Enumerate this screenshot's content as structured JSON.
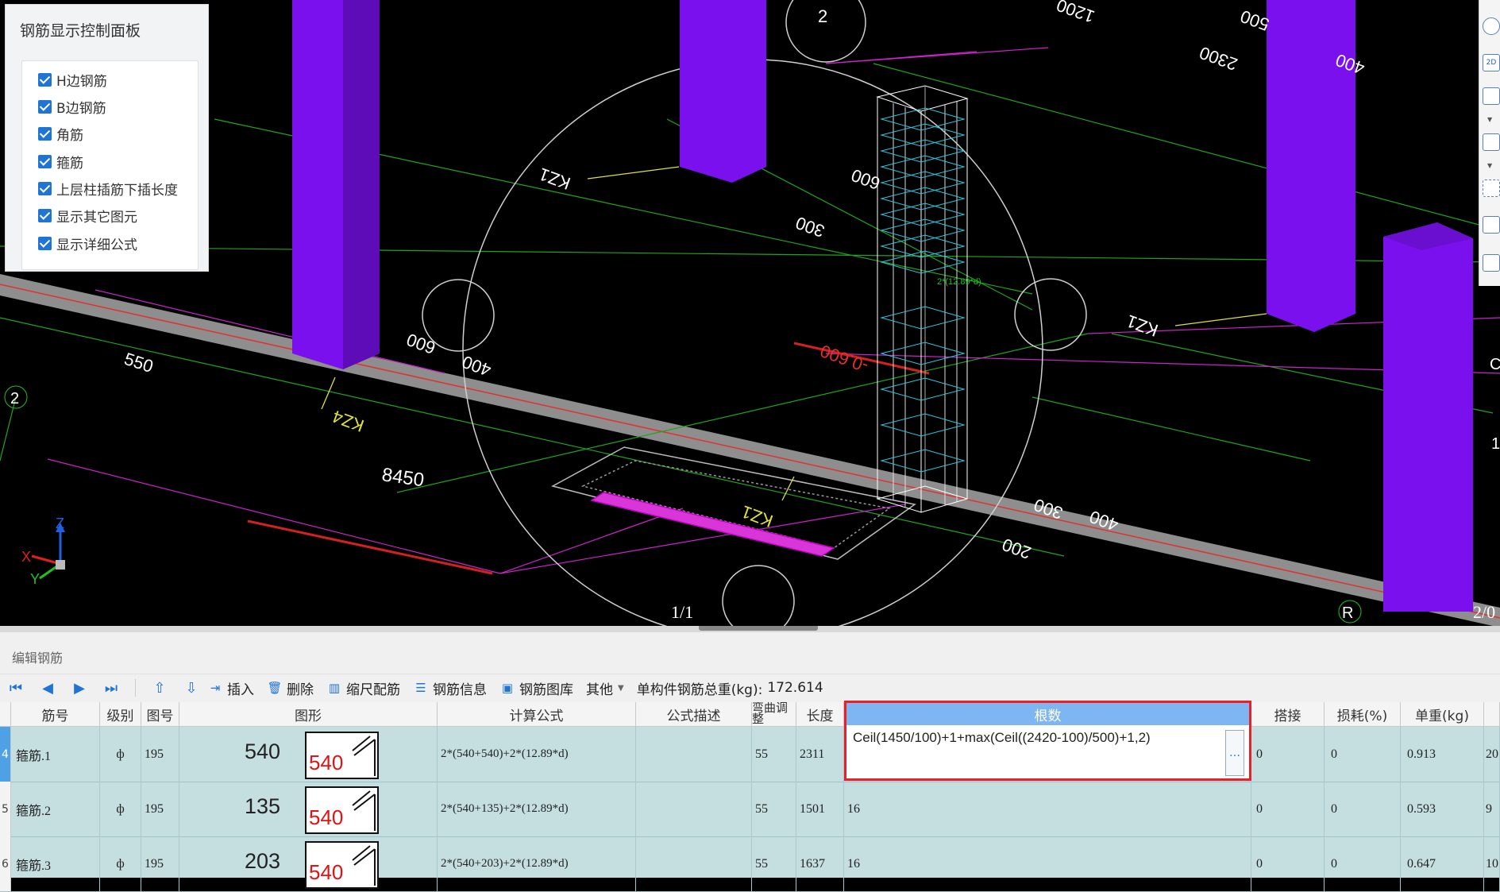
{
  "control_panel": {
    "title": "钢筋显示控制面板",
    "options": [
      {
        "label": "H边钢筋",
        "checked": true
      },
      {
        "label": "B边钢筋",
        "checked": true
      },
      {
        "label": "角筋",
        "checked": true
      },
      {
        "label": "箍筋",
        "checked": true
      },
      {
        "label": "上层柱插筋下插长度",
        "checked": true
      },
      {
        "label": "显示其它图元",
        "checked": true
      },
      {
        "label": "显示详细公式",
        "checked": true
      }
    ]
  },
  "scene": {
    "dims": {
      "d8450": "8450",
      "d550": "550",
      "d400a": "400",
      "d600": "600",
      "d300": "300",
      "d400b": "400",
      "d300b": "300",
      "d200": "200",
      "d2300": "2300",
      "d400c": "400",
      "d1200": "1200",
      "d500": "500",
      "d600b": "600"
    },
    "labels": {
      "kz1_top": "KZ1",
      "kz1_right": "KZ1",
      "kz4": "KZ4",
      "kz1_bottom": "KZ1",
      "level": "-0.600",
      "axis_2_top": "2",
      "axis_2_left": "2",
      "axis_r": "R",
      "page_left": "1/1",
      "page_right": "2/0",
      "edge_1": "1",
      "edge_c": "C",
      "formula_tag": "2*(12.89*d)"
    },
    "axes": {
      "z": "Z",
      "x": "X",
      "y": "Y"
    }
  },
  "right_toolbar": {
    "btn_2d": "2D"
  },
  "editor": {
    "title": "编辑钢筋",
    "toolbar": {
      "insert": "插入",
      "delete": "删除",
      "scale": "缩尺配筋",
      "info": "钢筋信息",
      "library": "钢筋图库",
      "other": "其他",
      "total_label": "单构件钢筋总重(kg):",
      "total_value": "172.614"
    },
    "columns": {
      "jinhao": "筋号",
      "jibie": "级别",
      "tuhao": "图号",
      "tuxing": "图形",
      "gongshi": "计算公式",
      "miaoshu": "公式描述",
      "wanqu": "弯曲调整",
      "changdu": "长度",
      "genshu": "根数",
      "dajie": "搭接",
      "sunhao": "损耗(%)",
      "danzhong": "单重(kg)"
    },
    "rows": [
      {
        "idx": "4",
        "name": "箍筋.1",
        "grade": "ф",
        "fig": "195",
        "dim": "540",
        "shape_label": "540",
        "formula": "2*(540+540)+2*(12.89*d)",
        "desc": "",
        "bend": "55",
        "length": "2311",
        "count": "Ceil(1450/100)+1+max(Ceil((2420-100)/500)+1,2)",
        "lap": "0",
        "loss": "0",
        "weight": "0.913",
        "extra": "20"
      },
      {
        "idx": "5",
        "name": "箍筋.2",
        "grade": "ф",
        "fig": "195",
        "dim": "135",
        "shape_label": "540",
        "formula": "2*(540+135)+2*(12.89*d)",
        "desc": "",
        "bend": "55",
        "length": "1501",
        "count": "16",
        "lap": "0",
        "loss": "0",
        "weight": "0.593",
        "extra": "9"
      },
      {
        "idx": "6",
        "name": "箍筋.3",
        "grade": "ф",
        "fig": "195",
        "dim": "203",
        "shape_label": "540",
        "formula": "2*(540+203)+2*(12.89*d)",
        "desc": "",
        "bend": "55",
        "length": "1637",
        "count": "16",
        "lap": "0",
        "loss": "0",
        "weight": "0.647",
        "extra": "10"
      }
    ]
  }
}
